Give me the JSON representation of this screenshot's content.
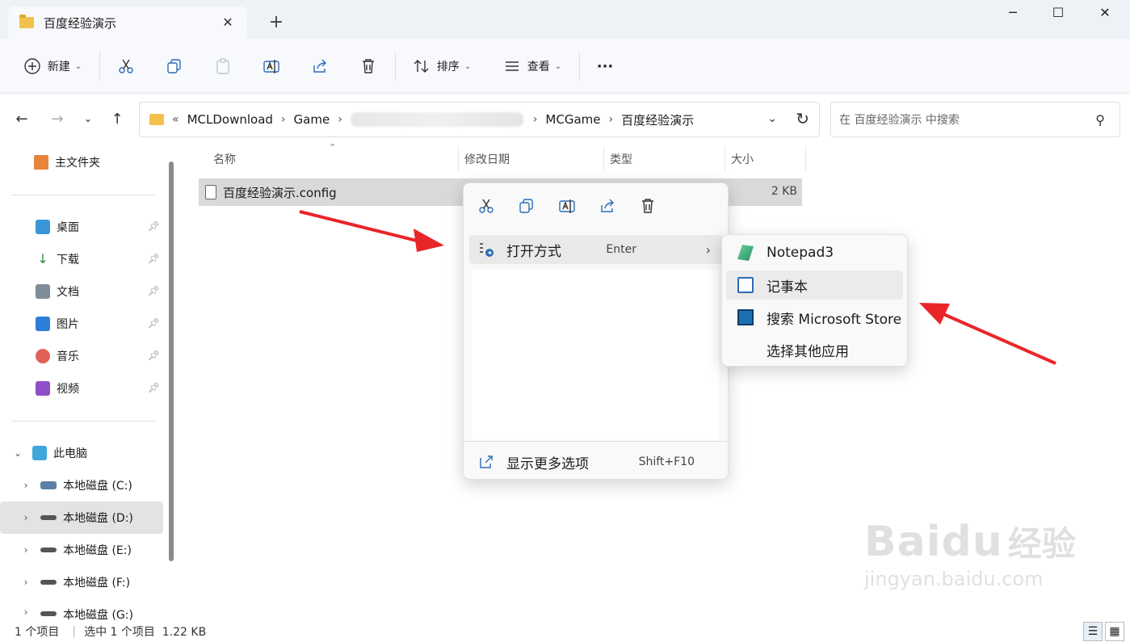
{
  "window": {
    "tab_title": "百度经验演示",
    "tab_close": "✕",
    "new_tab": "+",
    "minimize": "─",
    "maximize": "☐",
    "close": "✕"
  },
  "toolbar": {
    "new_label": "新建",
    "sort_label": "排序",
    "view_label": "查看",
    "more": "···"
  },
  "address": {
    "overflow": "«",
    "crumbs": [
      "MCLDownload",
      "Game",
      "MCGame",
      "百度经验演示"
    ],
    "search_placeholder": "在 百度经验演示 中搜索"
  },
  "sidebar": {
    "home": "主文件夹",
    "quick": [
      {
        "label": "桌面",
        "color": "#3b95d9"
      },
      {
        "label": "下载",
        "color": "#2b8a3e"
      },
      {
        "label": "文档",
        "color": "#7f8c99"
      },
      {
        "label": "图片",
        "color": "#2d7ed6"
      },
      {
        "label": "音乐",
        "color": "#e0625a"
      },
      {
        "label": "视频",
        "color": "#8f4fc9"
      }
    ],
    "thispc": "此电脑",
    "drives": [
      "本地磁盘 (C:)",
      "本地磁盘 (D:)",
      "本地磁盘 (E:)",
      "本地磁盘 (F:)",
      "本地磁盘 (G:)"
    ]
  },
  "columns": [
    "名称",
    "修改日期",
    "类型",
    "大小"
  ],
  "file": {
    "name": "百度经验演示.config",
    "size": "2 KB"
  },
  "context_menu": {
    "open_with": "打开方式",
    "open_with_shortcut": "Enter",
    "show_more": "显示更多选项",
    "show_more_shortcut": "Shift+F10"
  },
  "submenu": {
    "items": [
      "Notepad3",
      "记事本",
      "搜索 Microsoft Store",
      "选择其他应用"
    ]
  },
  "status": {
    "count": "1 个项目",
    "selected": "选中 1 个项目  1.22 KB"
  },
  "watermark": {
    "brand": "Baidu",
    "brand_cn": "经验",
    "url": "jingyan.baidu.com"
  },
  "colors": {
    "arrow": "#e8262a",
    "folder": "#f2c14b",
    "selection": "#d9d9d9"
  }
}
